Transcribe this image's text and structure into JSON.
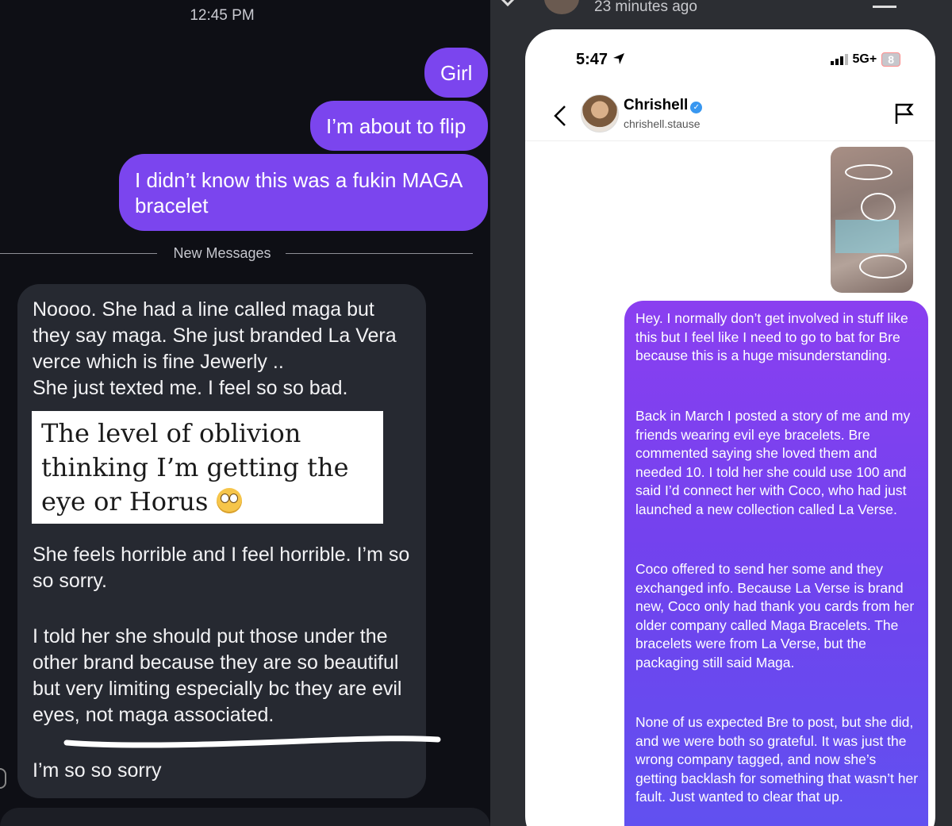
{
  "left": {
    "time": "12:45 PM",
    "outgoing": [
      "Girl",
      "I’m about to flip",
      "I didn’t know this was a fukin MAGA bracelet"
    ],
    "divider": "New Messages",
    "incoming": {
      "p1": "Noooo. She had a line called maga but they say maga. She just branded La Vera verce which is fine Jewerly ..",
      "p2": "She just texted me. I feel so so bad.",
      "quote": "The level of oblivion thinking I’m getting the eye or Horus",
      "p3": "She feels horrible and I feel horrible. I’m so so sorry.",
      "p4": "I told her she should put those under the other brand because they are so beautiful but very limiting especially bc they are evil eyes, not maga associated.",
      "p5": "I’m so so sorry"
    }
  },
  "right": {
    "story_time": "23 minutes ago",
    "status_time": "5:47",
    "network": "5G+",
    "battery": "8",
    "contact_name": "Chrishell",
    "contact_handle": "chrishell.stause",
    "paragraphs": [
      "Hey. I normally don’t get involved in stuff like this but I feel like I need to go to bat for Bre because this is a huge misunderstanding.",
      "Back in March I posted a story of me and my friends wearing evil eye bracelets. Bre commented saying she loved them and needed 10. I told her she could use 100 and said I’d connect her with Coco, who had just launched a new collection called La Verse.",
      "Coco offered to send her some and they exchanged info. Because La Verse is brand new, Coco only had thank you cards from her older company called Maga Bracelets. The bracelets were from La Verse, but the packaging still said Maga.",
      "None of us expected Bre to post, but she did, and we were both so grateful. It was just the wrong company tagged, and now she’s getting backlash for something that wasn’t her fault. Just wanted to clear that up."
    ]
  },
  "colors": {
    "outgoing_bubble": "#7b45ee",
    "incoming_bubble": "#262931",
    "right_gradient_top": "#8a3ff0",
    "right_gradient_bottom": "#5f52f0"
  },
  "icons": [
    "back-chevron-icon",
    "verified-badge-icon",
    "flag-icon",
    "location-arrow-icon",
    "signal-bars-icon",
    "emoji-icon"
  ]
}
